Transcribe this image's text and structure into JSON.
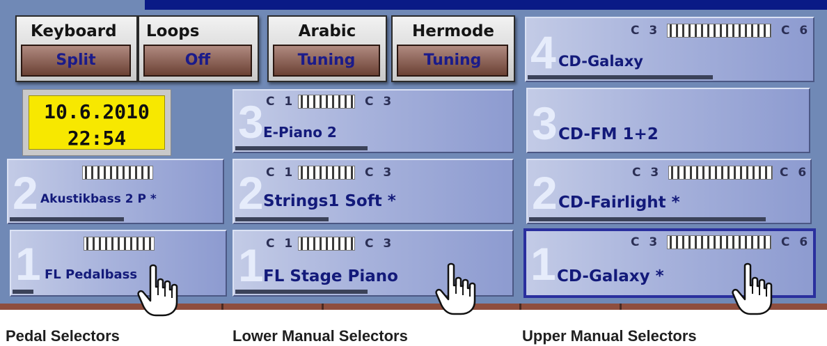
{
  "function_buttons": [
    {
      "title": "Keyboard",
      "value": "Split"
    },
    {
      "title": "Loops",
      "value": "Off"
    },
    {
      "title": "Arabic",
      "value": "Tuning"
    },
    {
      "title": "Hermode",
      "value": "Tuning"
    }
  ],
  "datetime": {
    "date": "10.6.2010",
    "time": "22:54"
  },
  "pedal": {
    "selectors": [
      {
        "number": "2",
        "sound": "Akustikbass 2 P *"
      },
      {
        "number": "1",
        "sound": "FL Pedalbass"
      }
    ]
  },
  "lower": {
    "range_low": "C 1",
    "range_high": "C 3",
    "selectors": [
      {
        "number": "3",
        "sound": "E-Piano 2"
      },
      {
        "number": "2",
        "sound": "Strings1 Soft *"
      },
      {
        "number": "1",
        "sound": "FL Stage Piano"
      }
    ]
  },
  "upper": {
    "range_low": "C 3",
    "range_high": "C 6",
    "selectors": [
      {
        "number": "4",
        "sound": "CD-Galaxy"
      },
      {
        "number": "3",
        "sound": "CD-FM 1+2"
      },
      {
        "number": "2",
        "sound": "CD-Fairlight *"
      },
      {
        "number": "1",
        "sound": "CD-Galaxy *",
        "selected": true
      }
    ]
  },
  "captions": {
    "pedal": "Pedal Selectors",
    "lower": "Lower Manual Selectors",
    "upper": "Upper Manual Selectors"
  },
  "icons": [
    "hand-pointer-icon",
    "keyboard-range-icon"
  ],
  "colors": {
    "screen_bg": "#7089b6",
    "top_bar": "#0a1a86",
    "selector_text": "#131a7a",
    "selected_border": "#2a2f9e",
    "clock_bg": "#f7e800",
    "function_value_bg": "#6b4134"
  }
}
